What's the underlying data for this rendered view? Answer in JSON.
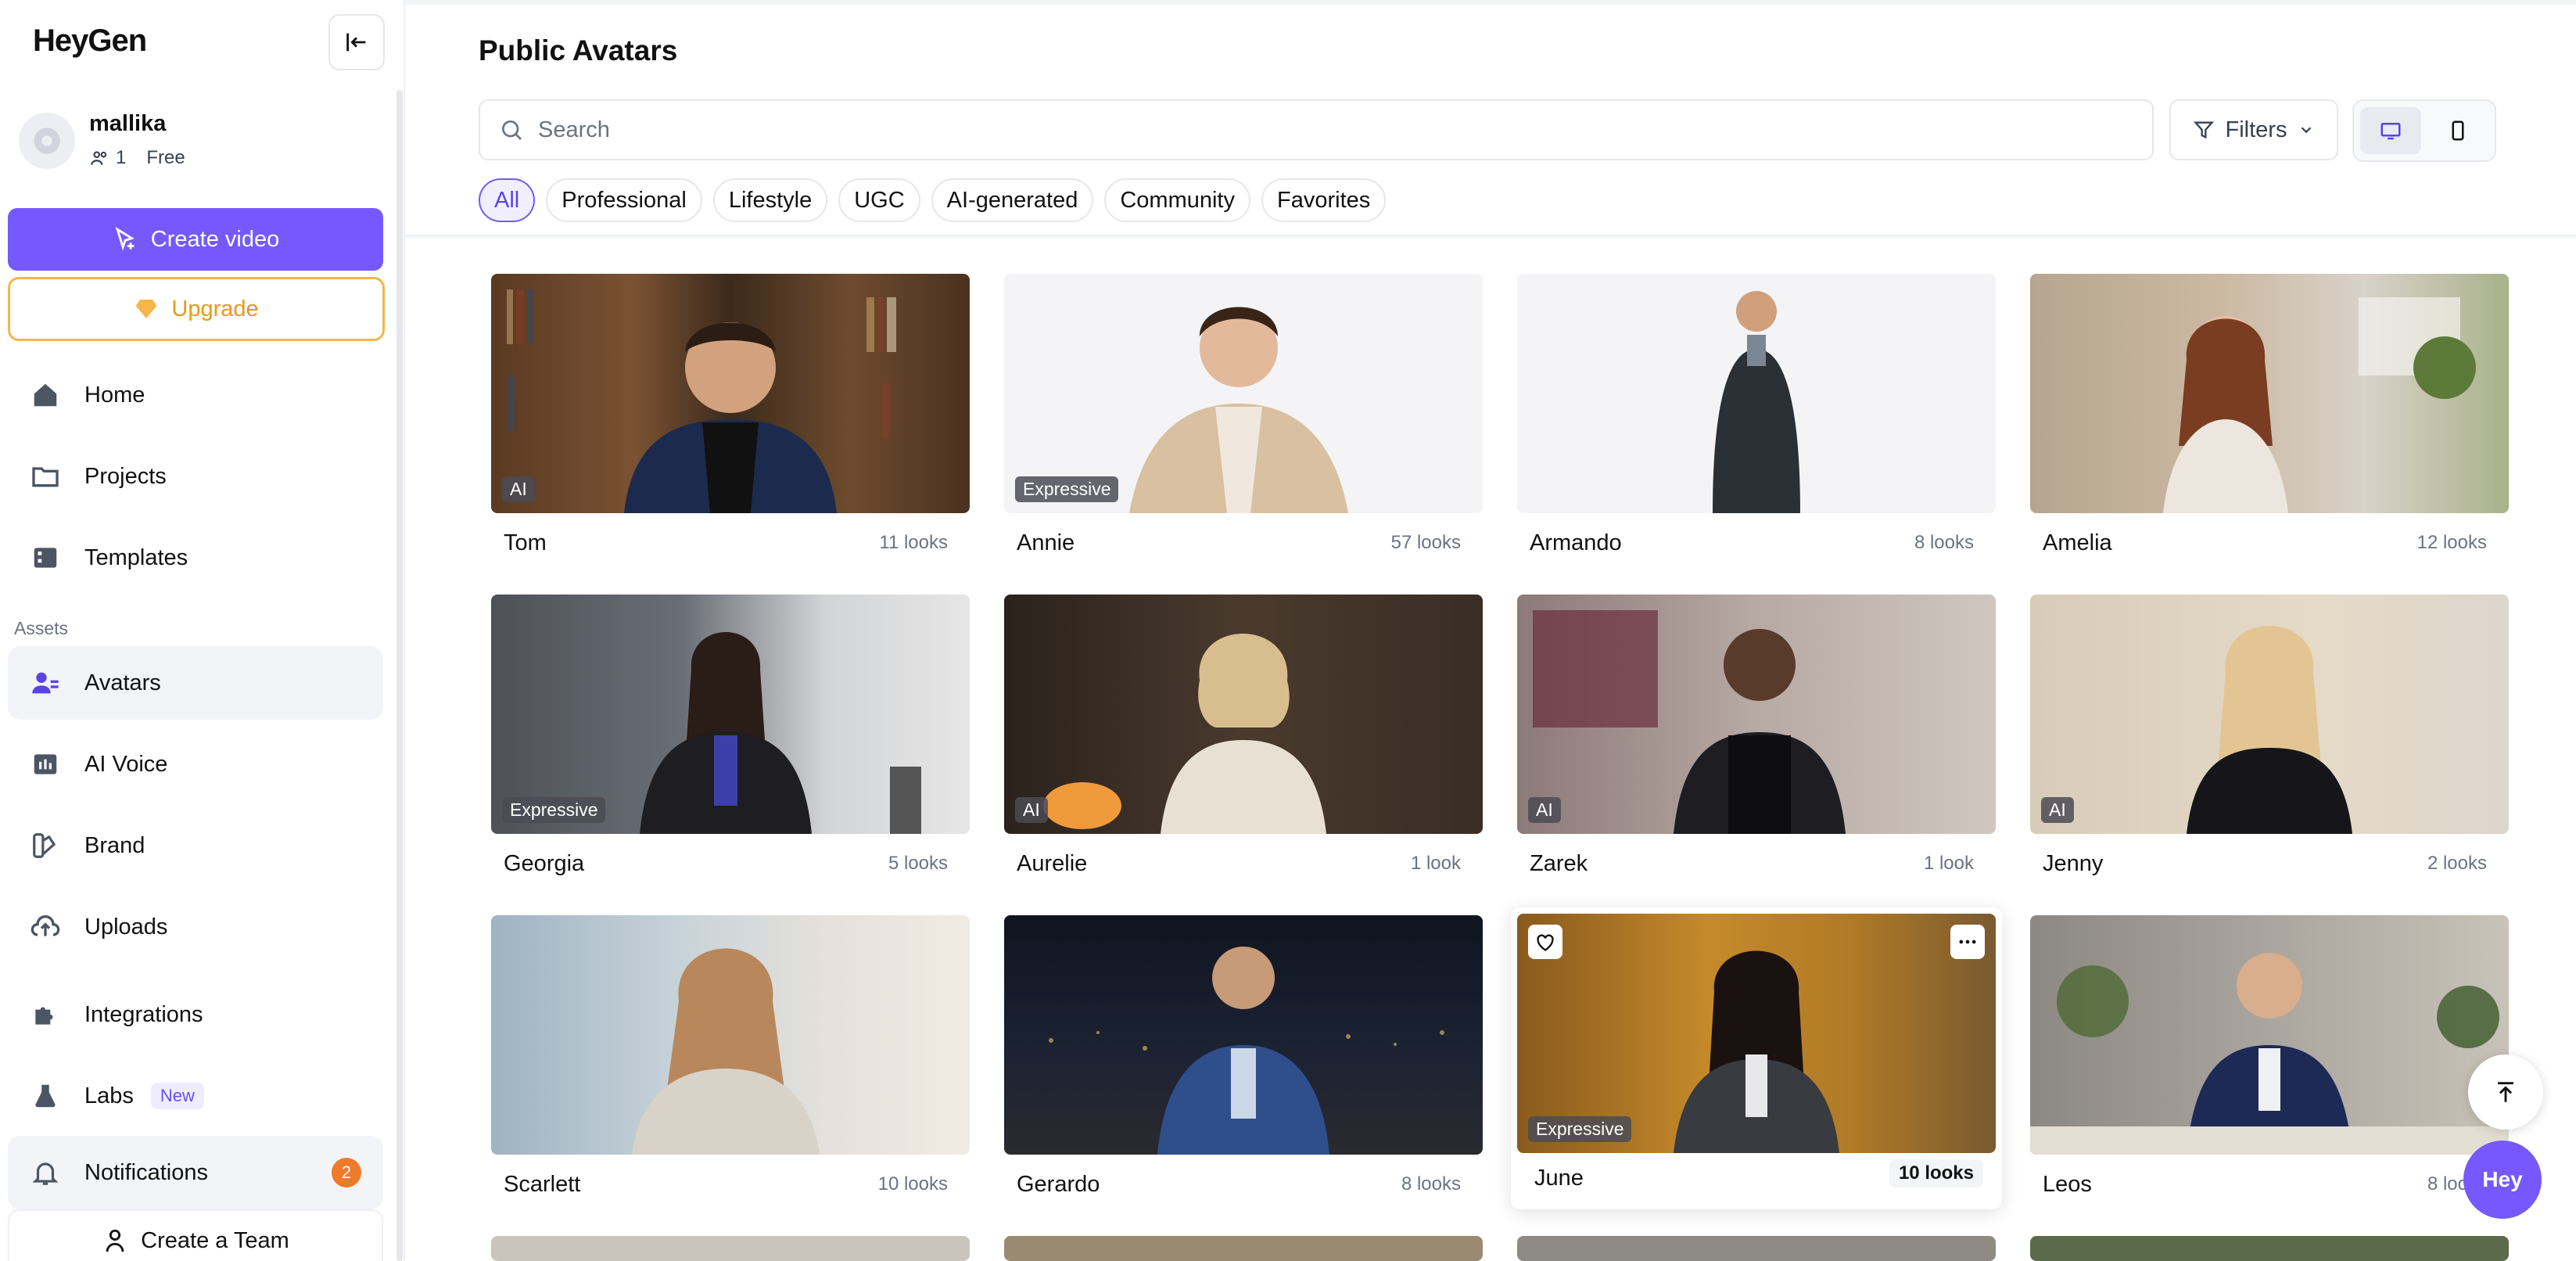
{
  "app": {
    "logo": "HeyGen",
    "brand_color": "#7559ff"
  },
  "user": {
    "name": "mallika",
    "members": "1",
    "plan": "Free"
  },
  "sidebar": {
    "create_label": "Create video",
    "upgrade_label": "Upgrade",
    "nav": [
      {
        "label": "Home",
        "icon": "home-icon"
      },
      {
        "label": "Projects",
        "icon": "folder-icon"
      },
      {
        "label": "Templates",
        "icon": "templates-icon"
      }
    ],
    "assets_label": "Assets",
    "assets": [
      {
        "label": "Avatars",
        "icon": "avatar-icon"
      },
      {
        "label": "AI Voice",
        "icon": "voice-icon"
      },
      {
        "label": "Brand",
        "icon": "brand-icon"
      },
      {
        "label": "Uploads",
        "icon": "upload-icon"
      },
      {
        "label": "Integrations",
        "icon": "puzzle-icon"
      },
      {
        "label": "Labs",
        "icon": "flask-icon"
      },
      {
        "label": "Notifications",
        "icon": "bell-icon"
      }
    ],
    "labs_badge": "New",
    "notifications_count": "2",
    "team_label": "Create a Team"
  },
  "main": {
    "title": "Public Avatars",
    "search_placeholder": "Search",
    "filters_label": "Filters",
    "chips": [
      "All",
      "Professional",
      "Lifestyle",
      "UGC",
      "AI-generated",
      "Community",
      "Favorites"
    ]
  },
  "avatars": [
    {
      "name": "Tom",
      "looks": "11 looks",
      "tag": "AI"
    },
    {
      "name": "Annie",
      "looks": "57 looks",
      "tag": "Expressive"
    },
    {
      "name": "Armando",
      "looks": "8 looks",
      "tag": ""
    },
    {
      "name": "Amelia",
      "looks": "12 looks",
      "tag": ""
    },
    {
      "name": "Georgia",
      "looks": "5 looks",
      "tag": "Expressive"
    },
    {
      "name": "Aurelie",
      "looks": "1 look",
      "tag": "AI"
    },
    {
      "name": "Zarek",
      "looks": "1 look",
      "tag": "AI"
    },
    {
      "name": "Jenny",
      "looks": "2 looks",
      "tag": "AI"
    },
    {
      "name": "Scarlett",
      "looks": "10 looks",
      "tag": ""
    },
    {
      "name": "Gerardo",
      "looks": "8 looks",
      "tag": ""
    },
    {
      "name": "June",
      "looks": "10 looks",
      "tag": "Expressive"
    },
    {
      "name": "Leos",
      "looks": "8 looks",
      "tag": ""
    }
  ],
  "chat_label": "Hey"
}
